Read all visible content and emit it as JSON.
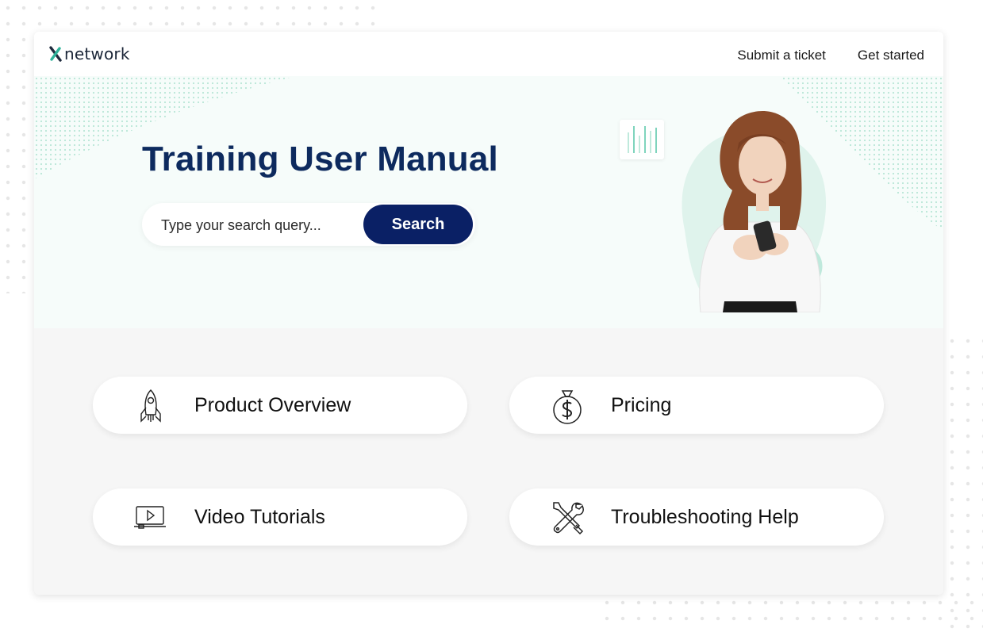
{
  "header": {
    "logo_text": "network",
    "nav": [
      {
        "label": "Submit a ticket"
      },
      {
        "label": "Get started"
      }
    ]
  },
  "hero": {
    "title": "Training User Manual",
    "search": {
      "placeholder": "Type your search query...",
      "value": "",
      "button_label": "Search"
    }
  },
  "tiles": [
    {
      "label": "Product Overview",
      "icon": "rocket-icon"
    },
    {
      "label": "Pricing",
      "icon": "money-bag-icon"
    },
    {
      "label": "Video Tutorials",
      "icon": "video-player-icon"
    },
    {
      "label": "Troubleshooting Help",
      "icon": "tools-icon"
    }
  ],
  "colors": {
    "brand_navy": "#0a2065",
    "title_navy": "#0d2a5e",
    "accent_teal": "#2fb39a",
    "mint": "#bfe9dc"
  }
}
